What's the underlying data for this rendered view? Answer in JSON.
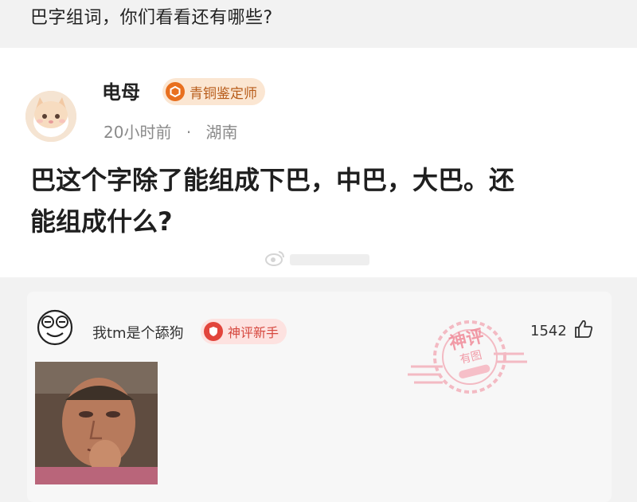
{
  "caption": "巴字组词，你们看看还有哪些?",
  "post": {
    "author": "电母",
    "badge": "青铜鉴定师",
    "time": "20小时前",
    "separator": "·",
    "location": "湖南",
    "text_line1": "巴这个字除了能组成下巴，中巴，大巴。还",
    "text_line2": "能组成什么?"
  },
  "reply": {
    "author": "我tm是个舔狗",
    "badge": "神评新手",
    "likes": "1542"
  },
  "stamp": {
    "line1": "神评",
    "line2": "有图"
  },
  "colors": {
    "badge_bronze": "#e86f1e",
    "badge_new": "#e2453c",
    "stamp": "#f08a99"
  }
}
